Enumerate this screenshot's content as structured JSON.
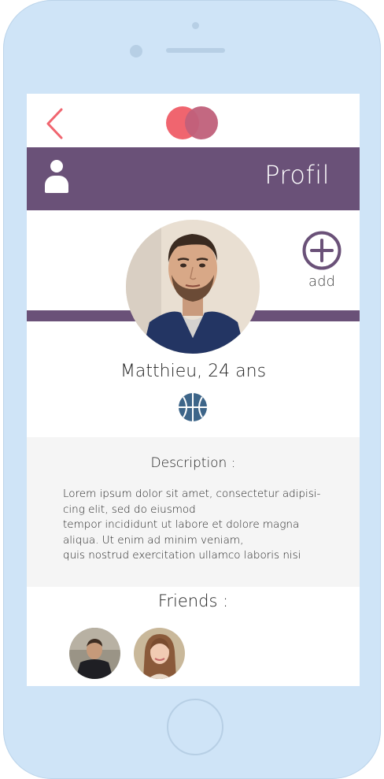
{
  "header": {
    "title": "Profil"
  },
  "profile": {
    "name": "Matthieu, 24 ans",
    "add_label": "add",
    "interest_icon": "basketball-icon"
  },
  "description": {
    "title": "Description :",
    "lines": [
      "Lorem ipsum dolor sit amet, consectetur adipisi-",
      "cing elit, sed do eiusmod",
      "tempor incididunt ut labore et dolore magna",
      "aliqua. Ut enim ad minim veniam,",
      "quis nostrud exercitation ullamco laboris nisi"
    ]
  },
  "friends": {
    "title": "Friends :"
  },
  "colors": {
    "accent_purple": "#6a5178",
    "logo_red": "#f0656f",
    "logo_pink": "#c0607a",
    "back_arrow": "#f0656f",
    "sport_blue": "#3d6589",
    "phone_frame": "#cfe4f7"
  }
}
